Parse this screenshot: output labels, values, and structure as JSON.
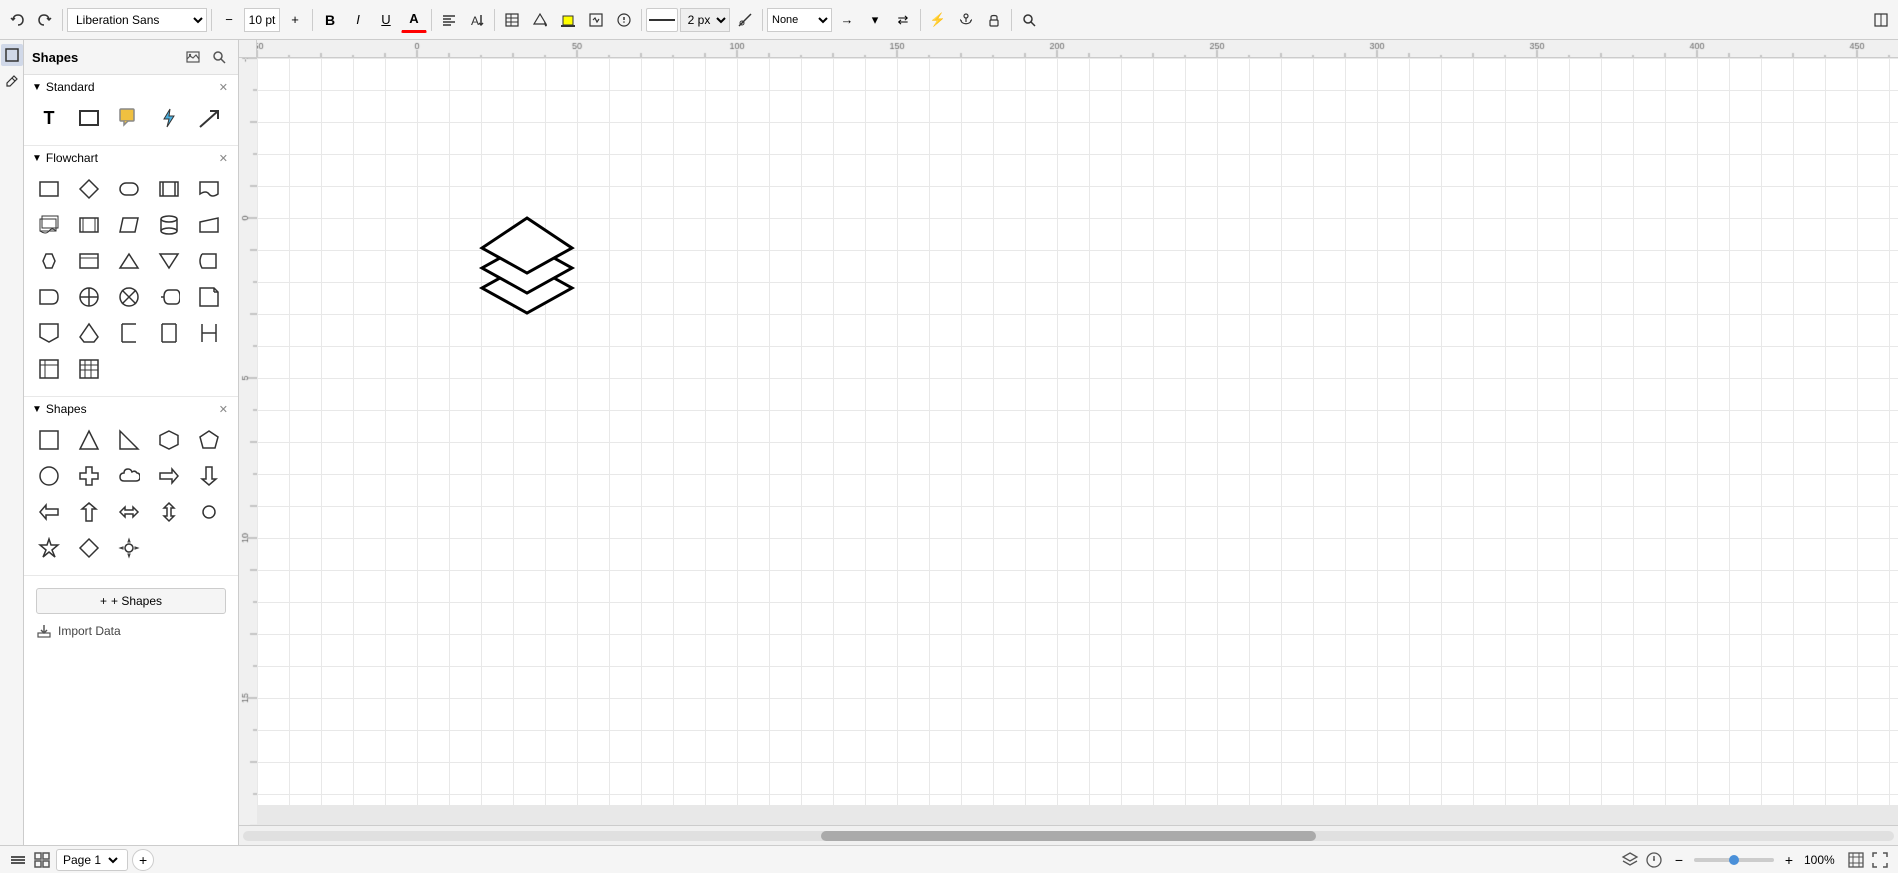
{
  "toolbar": {
    "undo_label": "←",
    "redo_label": "→",
    "font_family": "Liberation Sans",
    "font_size": "10 pt",
    "bold_label": "B",
    "italic_label": "I",
    "underline_label": "U",
    "font_color_label": "A",
    "align_left_label": "≡",
    "align_center_label": "≡",
    "shape_outline_label": "□",
    "fill_label": "◇",
    "line_style_label": "—",
    "line_width": "2 px",
    "connection_label": "⟋",
    "line_end_none": "None",
    "arrow_label": "→",
    "swap_label": "⇄",
    "flash_label": "⚡",
    "lock_label": "🔒",
    "extra_label": "✦"
  },
  "shapes_panel": {
    "title": "Shapes",
    "sections": [
      {
        "id": "standard",
        "title": "Standard",
        "items": [
          "T",
          "□",
          "■",
          "⚡",
          "↗"
        ]
      },
      {
        "id": "flowchart",
        "title": "Flowchart",
        "items": [
          "process",
          "decision",
          "terminal",
          "predefined",
          "document",
          "multi-doc",
          "subprocess",
          "data",
          "database",
          "manual-input",
          "preparation",
          "extract",
          "merge",
          "stored-data",
          "delay",
          "or",
          "summing-junction",
          "display",
          "note",
          "off-page-ref",
          "connector",
          "bracket-left",
          "bracket-both",
          "bar-left",
          "grid-simple",
          "grid-detail"
        ]
      },
      {
        "id": "shapes",
        "title": "Shapes",
        "items": [
          "square",
          "triangle",
          "right-triangle",
          "hexagon",
          "pentagon",
          "circle",
          "cross",
          "cloud",
          "arrow-right",
          "arrow-down",
          "arrow-left",
          "arrow-up",
          "arrow-double-h",
          "arrow-double-v",
          "circle-small",
          "star",
          "diamond",
          "gear"
        ]
      }
    ],
    "add_shapes_label": "+ Shapes",
    "import_data_label": "Import Data"
  },
  "canvas": {
    "shape": "stacked-diamonds"
  },
  "statusbar": {
    "layers_icon": "≡",
    "grid_icon": "⊞",
    "page_label": "Page 1",
    "add_page_label": "+",
    "zoom_minus": "−",
    "zoom_plus": "+",
    "zoom_percent": "100%",
    "fit_icon": "⊡",
    "fullscreen_icon": "⛶"
  }
}
